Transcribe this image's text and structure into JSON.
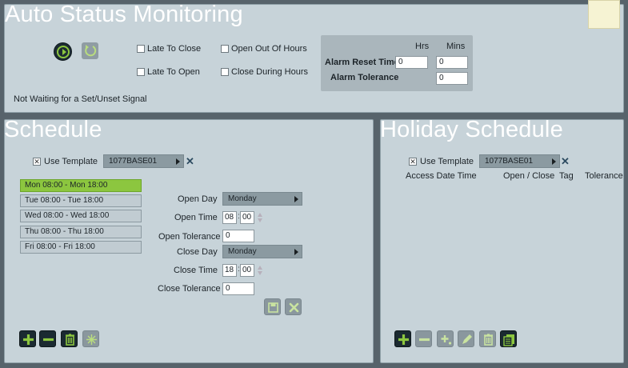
{
  "auto_status": {
    "title": "Auto Status Monitoring",
    "checkboxes": {
      "late_to_close": "Late To Close",
      "late_to_open": "Late To Open",
      "open_out_of_hours": "Open Out Of Hours",
      "close_during_hours": "Close During Hours"
    },
    "hrs_label": "Hrs",
    "mins_label": "Mins",
    "alarm_reset_time_label": "Alarm Reset Time",
    "alarm_reset_hrs": "0",
    "alarm_reset_mins": "0",
    "alarm_tolerance_label": "Alarm Tolerance",
    "alarm_tolerance_mins": "0",
    "status_text": "Not Waiting for a Set/Unset Signal"
  },
  "schedule": {
    "title": "Schedule",
    "use_template_label": "Use Template",
    "use_template_checked": "✕",
    "template_value": "1077BASE01",
    "days": [
      "Mon 08:00 - Mon 18:00",
      "Tue 08:00 - Tue 18:00",
      "Wed 08:00 - Wed 18:00",
      "Thu 08:00 - Thu 18:00",
      "Fri 08:00 - Fri 18:00"
    ],
    "open_day_label": "Open Day",
    "open_day_value": "Monday",
    "open_time_label": "Open Time",
    "open_time_hh": "08",
    "open_time_mm": "00",
    "open_tolerance_label": "Open Tolerance",
    "open_tolerance_value": "0",
    "close_day_label": "Close Day",
    "close_day_value": "Monday",
    "close_time_label": "Close Time",
    "close_time_hh": "18",
    "close_time_mm": "00",
    "close_tolerance_label": "Close Tolerance",
    "close_tolerance_value": "0"
  },
  "holiday": {
    "title": "Holiday Schedule",
    "use_template_label": "Use Template",
    "use_template_checked": "✕",
    "template_value": "1077BASE01",
    "columns": [
      "Access Date Time",
      "Open / Close",
      "Tag",
      "Tolerance"
    ]
  },
  "colors": {
    "accent_green": "#8cc63f",
    "panel_bg": "#c7d3d9",
    "page_bg": "#57636b"
  }
}
